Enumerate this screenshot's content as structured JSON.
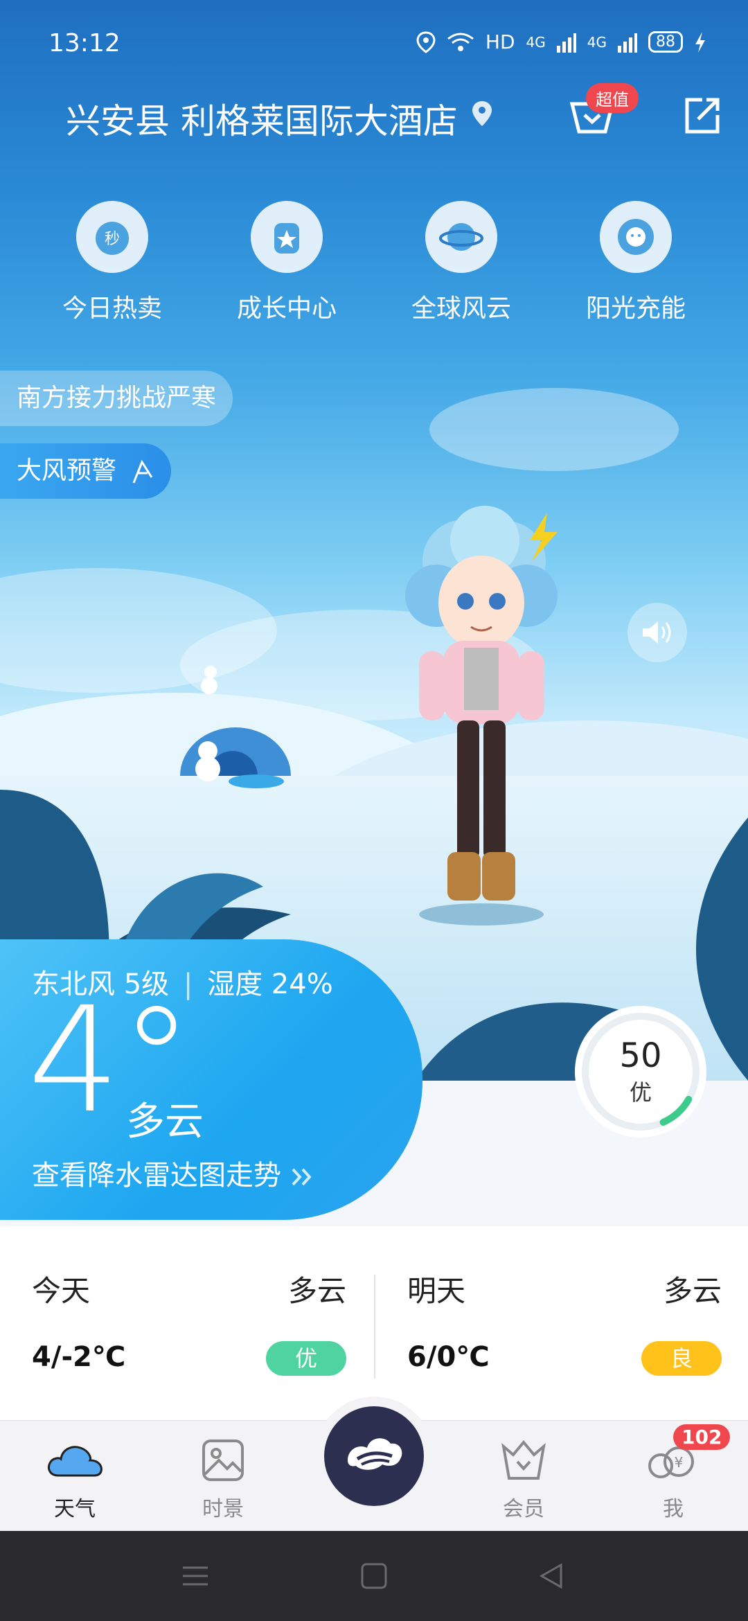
{
  "status": {
    "time": "13:12",
    "hd": "HD",
    "net1": "4G",
    "net2": "4G",
    "battery": "88"
  },
  "location": {
    "title": "兴安县 利格莱国际大酒店",
    "badge": "超值"
  },
  "quick_actions": [
    {
      "label": "今日热卖",
      "icon": "flash-sale-clock-icon"
    },
    {
      "label": "成长中心",
      "icon": "growth-medal-icon"
    },
    {
      "label": "全球风云",
      "icon": "planet-icon"
    },
    {
      "label": "阳光充能",
      "icon": "sun-flower-icon"
    }
  ],
  "banners": {
    "news": "南方接力挑战严寒",
    "warning": "大风预警"
  },
  "current": {
    "wind": "东北风 5级",
    "humidity": "湿度 24%",
    "temp": "4°",
    "condition": "多云",
    "radar": "查看降水雷达图走势"
  },
  "aqi": {
    "value": "50",
    "level": "优",
    "ring_fraction": 0.1
  },
  "forecast": [
    {
      "day": "今天",
      "condition": "多云",
      "range": "4/-2℃",
      "aq": "优",
      "aq_color": "#4fd3a0"
    },
    {
      "day": "明天",
      "condition": "多云",
      "range": "6/0℃",
      "aq": "良",
      "aq_color": "#ffc21a"
    }
  ],
  "tabs": [
    {
      "label": "天气",
      "icon": "cloud-icon",
      "active": true
    },
    {
      "label": "时景",
      "icon": "picture-icon",
      "active": false
    },
    {
      "label": "会员",
      "icon": "crown-basket-icon",
      "active": false
    },
    {
      "label": "我",
      "icon": "coins-icon",
      "active": false
    }
  ],
  "me_badge": "102"
}
